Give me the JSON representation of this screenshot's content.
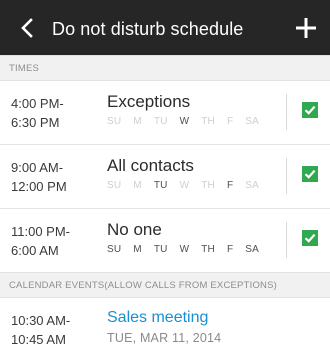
{
  "header": {
    "title": "Do not disturb schedule"
  },
  "sections": {
    "times": "TIMES",
    "calendar": "CALENDAR EVENTS(ALLOW CALLS FROM EXCEPTIONS)"
  },
  "schedules": [
    {
      "start": "4:00 PM-",
      "end": "6:30 PM",
      "name": "Exceptions",
      "days": [
        {
          "label": "SU",
          "active": false
        },
        {
          "label": "M",
          "active": false
        },
        {
          "label": "TU",
          "active": false
        },
        {
          "label": "W",
          "active": true
        },
        {
          "label": "TH",
          "active": false
        },
        {
          "label": "F",
          "active": false
        },
        {
          "label": "SA",
          "active": false
        }
      ],
      "checked": true
    },
    {
      "start": "9:00 AM-",
      "end": "12:00 PM",
      "name": "All contacts",
      "days": [
        {
          "label": "SU",
          "active": false
        },
        {
          "label": "M",
          "active": false
        },
        {
          "label": "TU",
          "active": true
        },
        {
          "label": "W",
          "active": false
        },
        {
          "label": "TH",
          "active": false
        },
        {
          "label": "F",
          "active": true
        },
        {
          "label": "SA",
          "active": false
        }
      ],
      "checked": true
    },
    {
      "start": "11:00 PM-",
      "end": "6:00 AM",
      "name": "No one",
      "days": [
        {
          "label": "SU",
          "active": true
        },
        {
          "label": "M",
          "active": true
        },
        {
          "label": "TU",
          "active": true
        },
        {
          "label": "W",
          "active": true
        },
        {
          "label": "TH",
          "active": true
        },
        {
          "label": "F",
          "active": true
        },
        {
          "label": "SA",
          "active": true
        }
      ],
      "checked": true
    }
  ],
  "events": [
    {
      "start": "10:30 AM-",
      "end": "10:45 AM",
      "title": "Sales meeting",
      "date": "TUE, MAR 11, 2014"
    }
  ],
  "colors": {
    "appbar": "#262626",
    "accent_green": "#2fa84f",
    "event_blue": "#1a8fd0",
    "header_bg": "#f1f1f1"
  }
}
